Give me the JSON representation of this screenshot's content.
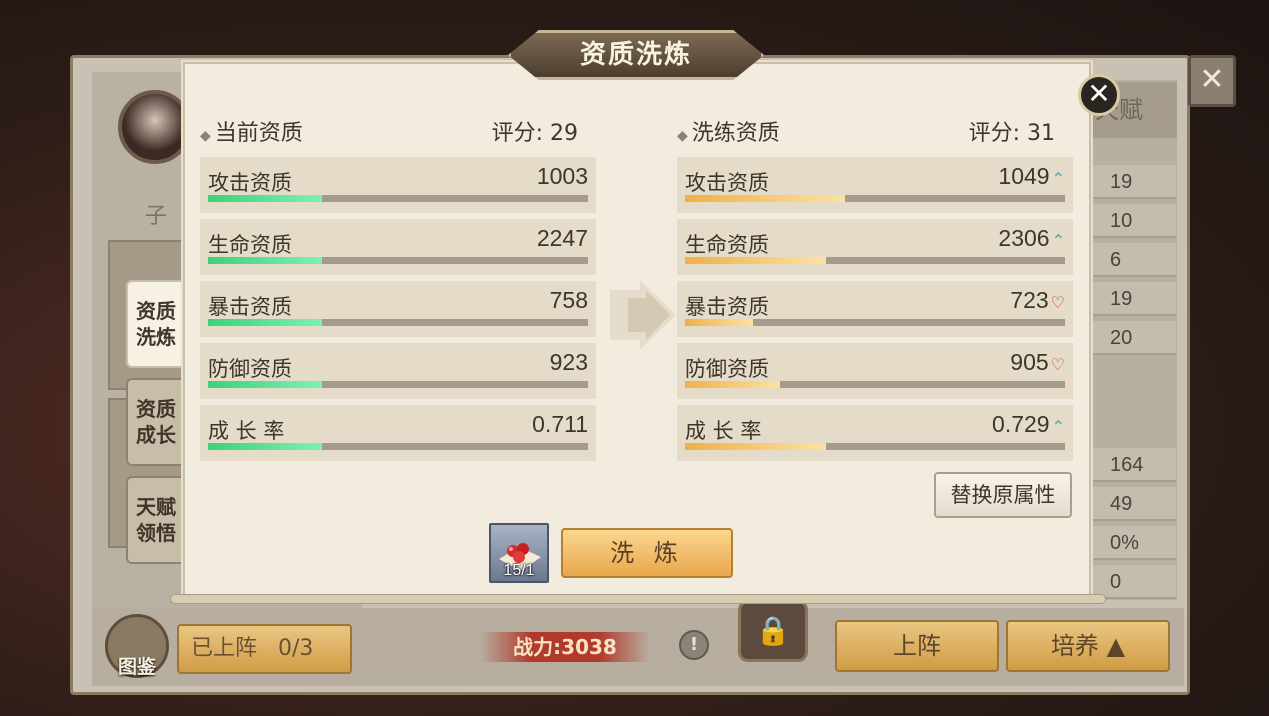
{
  "title": "资质洗炼",
  "background": {
    "name_partial": "子",
    "right_tab": "天赋",
    "right_values": [
      "19",
      "10",
      "6",
      "19",
      "20",
      "164",
      "49",
      "0%",
      "0"
    ],
    "tujian_label": "图鉴",
    "deployed": {
      "label": "已上阵",
      "count": "0/3"
    },
    "power_label": "战力:3038",
    "deploy_label": "上阵",
    "train_label": "培养"
  },
  "side_tabs": [
    {
      "line1": "资质",
      "line2": "洗炼"
    },
    {
      "line1": "资质",
      "line2": "成长"
    },
    {
      "line1": "天赋",
      "line2": "领悟"
    }
  ],
  "current": {
    "header": "当前资质",
    "score": "评分: 29",
    "rows": [
      {
        "name": "攻击资质",
        "value": "1003",
        "fill": 0.3
      },
      {
        "name": "生命资质",
        "value": "2247",
        "fill": 0.3
      },
      {
        "name": "暴击资质",
        "value": "758",
        "fill": 0.3
      },
      {
        "name": "防御资质",
        "value": "923",
        "fill": 0.3
      },
      {
        "name": "成 长 率",
        "value": "0.711",
        "fill": 0.3
      }
    ]
  },
  "refined": {
    "header": "洗练资质",
    "score": "评分: 31",
    "rows": [
      {
        "name": "攻击资质",
        "value": "1049",
        "trend": "up",
        "fill": 0.42
      },
      {
        "name": "生命资质",
        "value": "2306",
        "trend": "up",
        "fill": 0.37
      },
      {
        "name": "暴击资质",
        "value": "723",
        "trend": "down",
        "fill": 0.18
      },
      {
        "name": "防御资质",
        "value": "905",
        "trend": "down",
        "fill": 0.25
      },
      {
        "name": "成 长 率",
        "value": "0.729",
        "trend": "up",
        "fill": 0.37
      }
    ]
  },
  "replace_label": "替换原属性",
  "item_count": "15/1",
  "refine_label": "洗 炼",
  "close_symbol": "✕",
  "colors": {
    "green_bar": "#3dd17a",
    "gold_bar": "#f0b048",
    "up": "#48a8a0",
    "down": "#d33a3a"
  },
  "icons": {
    "close": "close-icon",
    "item": "red-pill-item-icon",
    "lock": "lock-icon",
    "info": "info-icon"
  }
}
